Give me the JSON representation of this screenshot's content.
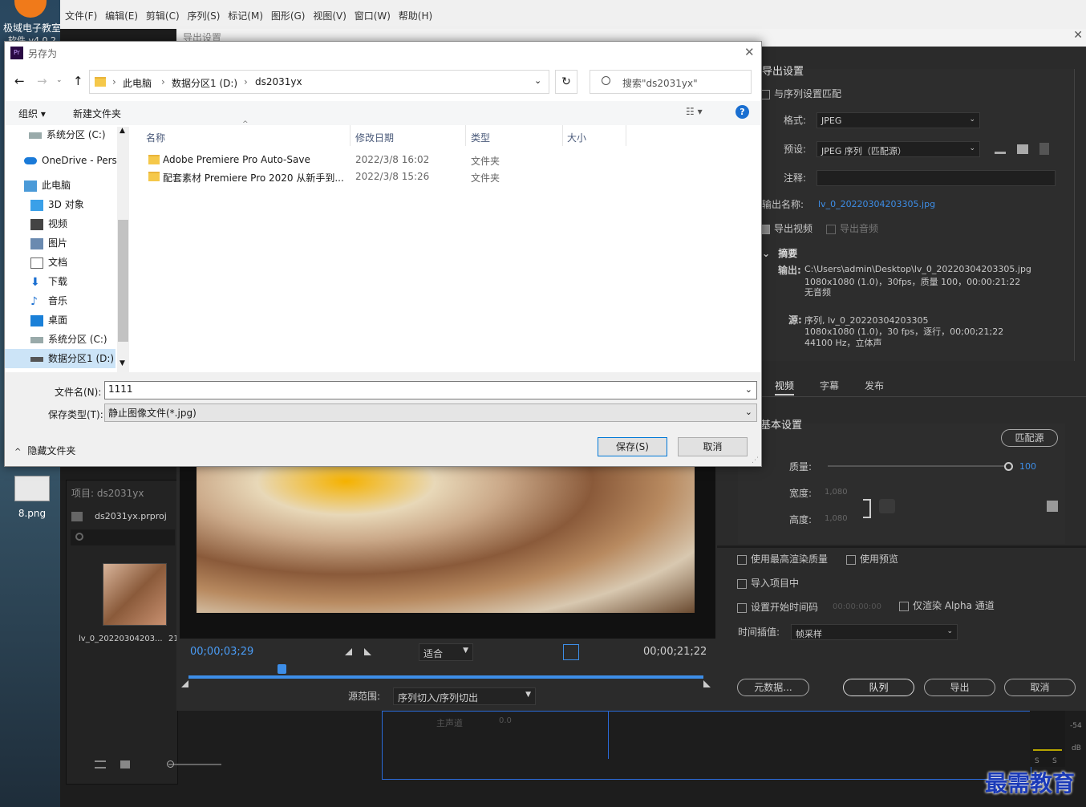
{
  "desktop": {
    "icon1_label": "极域电子教室",
    "icon1_label2": "软件 v4.0 2",
    "icon2_label": "8.png"
  },
  "premiere": {
    "menu": [
      "文件(F)",
      "编辑(E)",
      "剪辑(C)",
      "序列(S)",
      "标记(M)",
      "图形(G)",
      "视图(V)",
      "窗口(W)",
      "帮助(H)"
    ],
    "project_tab": "项目: ds2031yx",
    "project_file": "ds2031yx.prproj",
    "clip_name": "lv_0_20220304203...",
    "clip_dur": "21",
    "track_label": "主声道",
    "track_value": "0.0",
    "meter_54": "-54",
    "meter_db": "dB",
    "meter_s": "S"
  },
  "export": {
    "title": "导出设置",
    "section_title": "导出设置",
    "match_seq": "与序列设置匹配",
    "format_label": "格式:",
    "format_value": "JPEG",
    "preset_label": "预设:",
    "preset_value": "JPEG 序列（匹配源）",
    "comment_label": "注释:",
    "output_name_label": "输出名称:",
    "output_name_value": "lv_0_20220304203305.jpg",
    "export_video": "导出视频",
    "export_audio": "导出音频",
    "summary_label": "摘要",
    "output_label": "输出:",
    "output_line1": "C:\\Users\\admin\\Desktop\\lv_0_20220304203305.jpg",
    "output_line2": "1080x1080 (1.0)，30fps，质量 100，00:00:21:22",
    "output_line3": "无音频",
    "source_label": "源:",
    "source_line1": "序列, lv_0_20220304203305",
    "source_line2": "1080x1080 (1.0)，30 fps，逐行，00;00;21;22",
    "source_line3": "44100 Hz，立体声",
    "tab_video": "视频",
    "tab_caption": "字幕",
    "tab_publish": "发布",
    "basic_settings": "基本设置",
    "match_source_btn": "匹配源",
    "quality_label": "质量:",
    "quality_value": "100",
    "quality_fraction": 1.0,
    "width_label": "宽度:",
    "width_value": "1,080",
    "height_label": "高度:",
    "height_value": "1,080",
    "max_render": "使用最高渲染质量",
    "use_preview": "使用预览",
    "import_project": "导入项目中",
    "set_start_tc": "设置开始时间码",
    "start_tc_value": "00:00:00:00",
    "alpha_only": "仅渲染 Alpha 通道",
    "time_interp_label": "时间插值:",
    "time_interp_value": "帧采样",
    "metadata_btn": "元数据...",
    "queue_btn": "队列",
    "export_btn": "导出",
    "cancel_btn": "取消",
    "timecode_left": "00;00;03;29",
    "timecode_right": "00;00;21;22",
    "fit_value": "适合",
    "source_range_label": "源范围:",
    "source_range_value": "序列切入/序列切出",
    "playhead_fraction": 0.18
  },
  "save_dialog": {
    "title": "另存为",
    "breadcrumb": [
      "此电脑",
      "数据分区1 (D:)",
      "ds2031yx"
    ],
    "search_placeholder": "搜索\"ds2031yx\"",
    "organize": "组织 ▾",
    "new_folder": "新建文件夹",
    "nav_items": [
      "系统分区 (C:)",
      "OneDrive - Pers",
      "此电脑",
      "3D 对象",
      "视频",
      "图片",
      "文档",
      "下载",
      "音乐",
      "桌面",
      "系统分区 (C:)",
      "数据分区1 (D:)"
    ],
    "columns": [
      "名称",
      "修改日期",
      "类型",
      "大小"
    ],
    "files": [
      {
        "name": "Adobe Premiere Pro Auto-Save",
        "date": "2022/3/8 16:02",
        "type": "文件夹"
      },
      {
        "name": "配套素材 Premiere Pro 2020 从新手到...",
        "date": "2022/3/8 15:26",
        "type": "文件夹"
      }
    ],
    "filename_label": "文件名(N):",
    "filename_value": "1111",
    "filetype_label": "保存类型(T):",
    "filetype_value": "静止图像文件(*.jpg)",
    "hide_folders": "隐藏文件夹",
    "save_btn": "保存(S)",
    "cancel_btn": "取消"
  },
  "watermark": "最需教育"
}
